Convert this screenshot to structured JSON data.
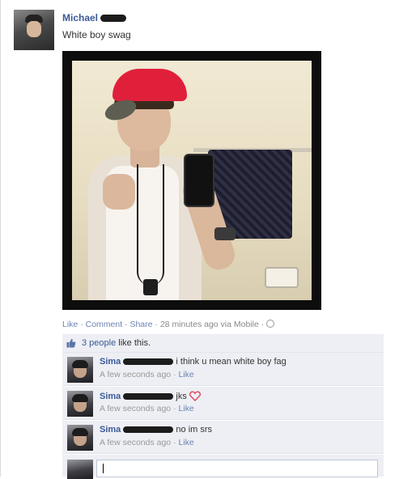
{
  "post": {
    "author": "Michael",
    "status": "White boy swag"
  },
  "actions": {
    "like": "Like",
    "comment": "Comment",
    "share": "Share",
    "time": "28 minutes ago via Mobile",
    "sep": "·"
  },
  "likes": {
    "count_text": "3 people",
    "suffix": "like this."
  },
  "comments": [
    {
      "author": "Sima",
      "text": "i think u mean white boy fag",
      "time": "A few seconds ago",
      "like": "Like"
    },
    {
      "author": "Sima",
      "text": "jks",
      "time": "A few seconds ago",
      "like": "Like"
    },
    {
      "author": "Sima",
      "text": "no im srs",
      "time": "A few seconds ago",
      "like": "Like"
    }
  ],
  "colors": {
    "link": "#3b5998",
    "heart": "#e2445c"
  },
  "icons": {
    "like_icon": "thumbs-up-icon",
    "privacy_icon": "globe-icon",
    "emoticon": "heart-icon"
  }
}
